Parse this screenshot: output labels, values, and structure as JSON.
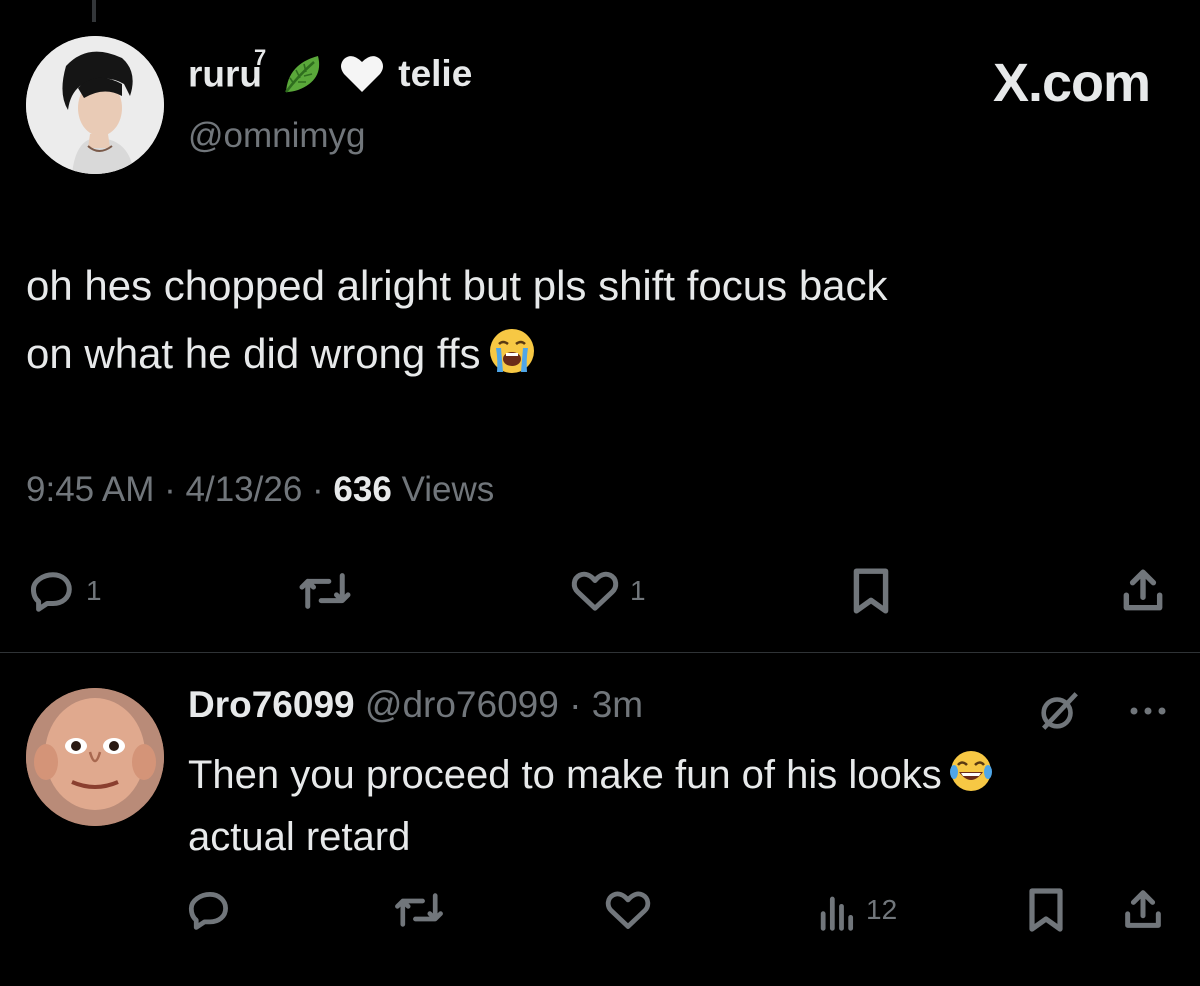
{
  "main_tweet": {
    "display_name": "ruru",
    "name_superscript": "7",
    "name_suffix": "telie",
    "handle": "@omnimyg",
    "watermark": "X.com",
    "text_line1": "oh hes chopped alright but pls shift focus back",
    "text_line2": "on what he did wrong ffs",
    "time": "9:45 AM",
    "date": "4/13/26",
    "views_count": "636",
    "views_label": "Views",
    "replies": "1",
    "likes": "1",
    "icons": [
      "reply-icon",
      "retweet-icon",
      "like-icon",
      "bookmark-icon",
      "share-icon"
    ]
  },
  "reply": {
    "display_name": "Dro76099",
    "handle": "@dro76099",
    "time_ago": "3m",
    "text_line1": "Then you proceed to make fun of his looks",
    "text_line2": "actual retard",
    "views": "12",
    "icons": [
      "reply-icon",
      "retweet-icon",
      "like-icon",
      "views-icon",
      "bookmark-icon",
      "share-icon",
      "grok-icon",
      "more-icon"
    ]
  },
  "colors": {
    "background": "#000000",
    "text": "#e7e9ea",
    "muted": "#71767b",
    "divider": "#2f3336"
  }
}
